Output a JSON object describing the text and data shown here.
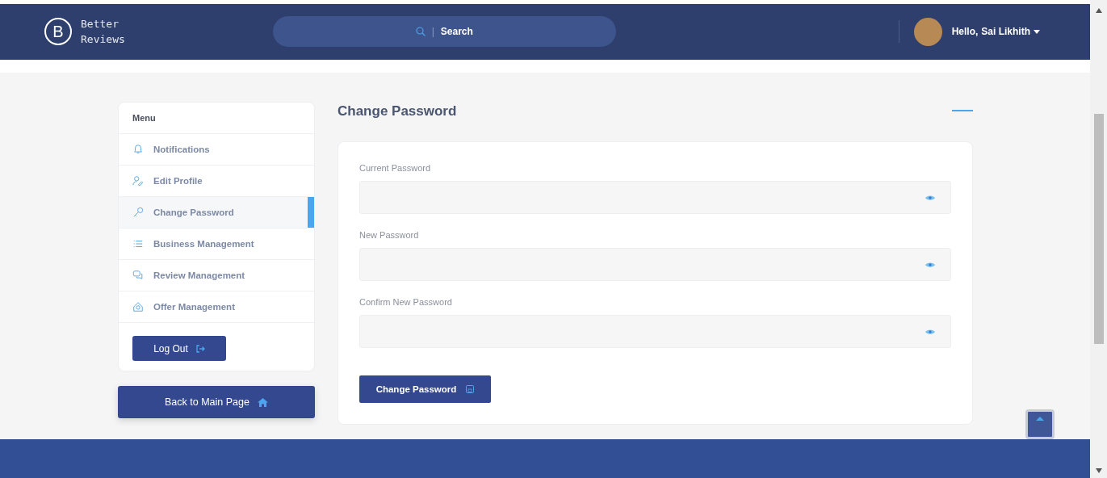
{
  "header": {
    "logo_letter": "B",
    "brand_line_1": "Better",
    "brand_line_2": "Reviews",
    "search": {
      "divider": "|",
      "placeholder": "Search"
    },
    "user": {
      "greeting": "Hello,",
      "name": "Sai Likhith"
    }
  },
  "sidebar": {
    "title": "Menu",
    "items": [
      {
        "label": "Notifications",
        "selected": false
      },
      {
        "label": "Edit Profile",
        "selected": false
      },
      {
        "label": "Change Password",
        "selected": true
      },
      {
        "label": "Business Management",
        "selected": false
      },
      {
        "label": "Review Management",
        "selected": false
      },
      {
        "label": "Offer Management",
        "selected": false
      }
    ],
    "logout": "Log Out",
    "back": "Back to Main Page"
  },
  "main": {
    "title": "Change Password",
    "fields": [
      {
        "label": "Current Password"
      },
      {
        "label": "New Password"
      },
      {
        "label": "Confirm New Password"
      }
    ],
    "submit": "Change Password"
  }
}
